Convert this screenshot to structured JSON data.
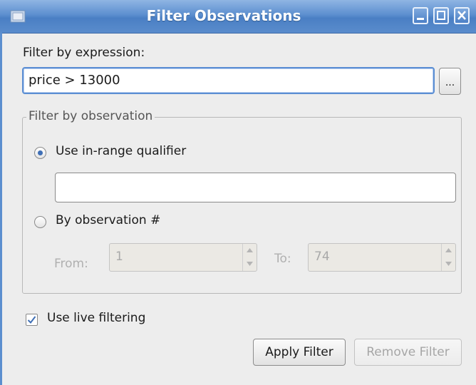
{
  "window": {
    "title": "Filter Observations",
    "buttons": [
      "minimize",
      "maximize",
      "close"
    ]
  },
  "expression": {
    "label": "Filter by expression:",
    "value": "price > 13000",
    "browse_label": "..."
  },
  "observation_group": {
    "title": "Filter by observation",
    "in_range": {
      "label": "Use in-range qualifier",
      "selected": true,
      "value": ""
    },
    "by_number": {
      "label": "By observation #",
      "selected": false
    },
    "from": {
      "label": "From:",
      "value": "1"
    },
    "to": {
      "label": "To:",
      "value": "74"
    }
  },
  "live_filtering": {
    "label": "Use live filtering",
    "checked": true
  },
  "actions": {
    "apply_label": "Apply Filter",
    "remove_label": "Remove Filter"
  },
  "colors": {
    "titlebar": "#5c8fcf",
    "accent": "#3f6fb5",
    "focus_border": "#5b8ed3"
  }
}
